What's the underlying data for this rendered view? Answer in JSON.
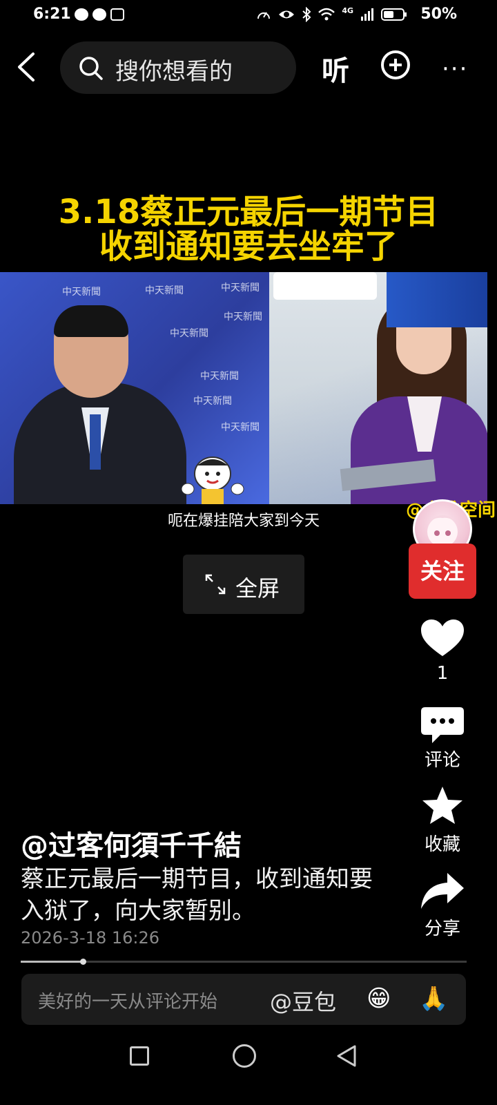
{
  "status_bar": {
    "time": "6:21",
    "battery": "50%",
    "network": "4G"
  },
  "top_bar": {
    "search_placeholder": "搜你想看的",
    "listen_label": "听",
    "more_label": "···"
  },
  "video": {
    "title_line1": "3.18蔡正元最后一期节目",
    "title_line2": "收到通知要去坐牢了",
    "caption": "呃在爆挂陪大家到今天",
    "watermark": "@六维空间",
    "channel_watermark": "中天新聞",
    "fullscreen_label": "全屏"
  },
  "side_rail": {
    "follow_label": "关注",
    "like_count": "1",
    "comment_label": "评论",
    "collect_label": "收藏",
    "share_label": "分享"
  },
  "post": {
    "author": "@过客何須千千結",
    "description": "蔡正元最后一期节目，收到通知要入狱了，向大家暂别。",
    "date": "2026-3-18 16:26",
    "progress": 0.14
  },
  "comment_bar": {
    "placeholder": "美好的一天从评论开始",
    "mention": "@豆包",
    "emoji1": "😁",
    "emoji2": "🙏"
  },
  "colors": {
    "title_yellow": "#f5d400",
    "follow_red": "#e02d2d"
  }
}
